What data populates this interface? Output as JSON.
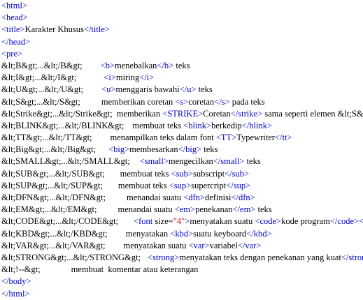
{
  "colors": {
    "tag": "#0000cc",
    "entity": "#000000",
    "text": "#000000",
    "attr_value": "#cc0000"
  },
  "lines": [
    [
      {
        "t": "tag",
        "v": "<html>"
      }
    ],
    [
      {
        "t": "tag",
        "v": "<head>"
      }
    ],
    [
      {
        "t": "tag",
        "v": "<title>"
      },
      {
        "t": "txt",
        "v": "Karakter Khusus"
      },
      {
        "t": "tag",
        "v": "</title>"
      }
    ],
    [
      {
        "t": "tag",
        "v": "</head>"
      }
    ],
    [
      {
        "t": "tag",
        "v": "<pre>"
      }
    ],
    [
      {
        "t": "ent",
        "v": "&lt;B&gt;...&lt;/B&gt;"
      },
      {
        "t": "sp",
        "w": 26
      },
      {
        "t": "tag",
        "v": "<b>"
      },
      {
        "t": "txt",
        "v": "menebalkan"
      },
      {
        "t": "tag",
        "v": "</b>"
      },
      {
        "t": "txt",
        "v": " teks"
      }
    ],
    [
      {
        "t": "ent",
        "v": "&lt;I&gt;...&lt;/I&gt;"
      },
      {
        "t": "sp",
        "w": 39
      },
      {
        "t": "tag",
        "v": "<i>"
      },
      {
        "t": "txt",
        "v": "miring"
      },
      {
        "t": "tag",
        "v": "</i>"
      }
    ],
    [
      {
        "t": "ent",
        "v": "&lt;U&gt;...&lt;/U&gt;"
      },
      {
        "t": "sp",
        "w": 26
      },
      {
        "t": "tag",
        "v": "<u>"
      },
      {
        "t": "txt",
        "v": "menggaris bawahi"
      },
      {
        "t": "tag",
        "v": "</u>"
      },
      {
        "t": "txt",
        "v": " teks"
      }
    ],
    [
      {
        "t": "ent",
        "v": "&lt;S&gt;...&lt;/S&gt;"
      },
      {
        "t": "sp",
        "w": 30
      },
      {
        "t": "txt",
        "v": "memberikan coretan "
      },
      {
        "t": "tag",
        "v": "<s>"
      },
      {
        "t": "txt",
        "v": "coretan"
      },
      {
        "t": "tag",
        "v": "</s>"
      },
      {
        "t": "txt",
        "v": " pada teks"
      }
    ],
    [
      {
        "t": "ent",
        "v": "&lt;Strike&gt;...&lt;/Strike&gt;"
      },
      {
        "t": "sp",
        "w": 6
      },
      {
        "t": "txt",
        "v": "memberikan "
      },
      {
        "t": "tag",
        "v": "<STRIKE>"
      },
      {
        "t": "txt",
        "v": "Coretan"
      },
      {
        "t": "tag",
        "v": "</strike>"
      },
      {
        "t": "txt",
        "v": " sama seperti elemen &lt;S&gt;"
      }
    ],
    [
      {
        "t": "ent",
        "v": "&lt;BLINK&gt;...&lt;/BLINK&gt;"
      },
      {
        "t": "sp",
        "w": 12
      },
      {
        "t": "txt",
        "v": "membuat teks "
      },
      {
        "t": "tag",
        "v": "<blink>"
      },
      {
        "t": "txt",
        "v": "berkedip"
      },
      {
        "t": "tag",
        "v": "</blink>"
      }
    ],
    [
      {
        "t": "ent",
        "v": "&lt;TT&gt;...&lt;/TT&gt;"
      },
      {
        "t": "sp",
        "w": 26
      },
      {
        "t": "txt",
        "v": "menampilkan teks dalam font "
      },
      {
        "t": "tag",
        "v": "<TT>"
      },
      {
        "t": "txt",
        "v": "Typewriter"
      },
      {
        "t": "tag",
        "v": "</tt>"
      }
    ],
    [
      {
        "t": "ent",
        "v": "&lt;Big&gt;...&lt;/Big&gt;"
      },
      {
        "t": "sp",
        "w": 18
      },
      {
        "t": "tag",
        "v": "<big>"
      },
      {
        "t": "txt",
        "v": "membesarkan"
      },
      {
        "t": "tag",
        "v": "</big>"
      },
      {
        "t": "txt",
        "v": " teks"
      }
    ],
    [
      {
        "t": "ent",
        "v": "&lt;SMALL&gt;...&lt;/SMALL&gt;"
      },
      {
        "t": "sp",
        "w": 14
      },
      {
        "t": "tag",
        "v": "<small>"
      },
      {
        "t": "txt",
        "v": "mengecilkan"
      },
      {
        "t": "tag",
        "v": "</small>"
      },
      {
        "t": "txt",
        "v": " teks"
      }
    ],
    [
      {
        "t": "ent",
        "v": "&lt;SUB&gt;...&lt;/SUB&gt;"
      },
      {
        "t": "sp",
        "w": 22
      },
      {
        "t": "txt",
        "v": "membuat teks "
      },
      {
        "t": "tag",
        "v": "<sub>"
      },
      {
        "t": "txt",
        "v": "subscript"
      },
      {
        "t": "tag",
        "v": "</sub>"
      }
    ],
    [
      {
        "t": "ent",
        "v": "&lt;SUP&gt;...&lt;/SUP&gt;"
      },
      {
        "t": "sp",
        "w": 22
      },
      {
        "t": "txt",
        "v": "membuat teks "
      },
      {
        "t": "tag",
        "v": "<sup>"
      },
      {
        "t": "txt",
        "v": "supercript"
      },
      {
        "t": "tag",
        "v": "</sup>"
      }
    ],
    [
      {
        "t": "ent",
        "v": "&lt;DFN&gt;...&lt;/DFN&gt;"
      },
      {
        "t": "sp",
        "w": 30
      },
      {
        "t": "txt",
        "v": "menandai suatu "
      },
      {
        "t": "tag",
        "v": "<dfn>"
      },
      {
        "t": "txt",
        "v": "definisi"
      },
      {
        "t": "tag",
        "v": "</dfn>"
      }
    ],
    [
      {
        "t": "ent",
        "v": "&lt;EM&gt;...&lt;/EM&gt;"
      },
      {
        "t": "sp",
        "w": 30
      },
      {
        "t": "txt",
        "v": "menandai suatu "
      },
      {
        "t": "tag",
        "v": "<em>"
      },
      {
        "t": "txt",
        "v": "penekanan"
      },
      {
        "t": "tag",
        "v": "</em>"
      },
      {
        "t": "txt",
        "v": " teks"
      }
    ],
    [
      {
        "t": "ent",
        "v": "&lt;CODE&gt;...&lt;/CODE&gt;"
      },
      {
        "t": "sp",
        "w": 22
      },
      {
        "t": "tag",
        "v": "<font"
      },
      {
        "t": "txt",
        "v": " size="
      },
      {
        "t": "val",
        "v": "\"4\""
      },
      {
        "t": "tag",
        "v": ">"
      },
      {
        "t": "txt",
        "v": "menyatakan suatu "
      },
      {
        "t": "tag",
        "v": "<code>"
      },
      {
        "t": "txt",
        "v": "kode program"
      },
      {
        "t": "tag",
        "v": "</code></font>"
      }
    ],
    [
      {
        "t": "ent",
        "v": "&lt;KBD&gt;...&lt;/KBD&gt;"
      },
      {
        "t": "sp",
        "w": 26
      },
      {
        "t": "txt",
        "v": "menyatakan "
      },
      {
        "t": "tag",
        "v": "<kbd>"
      },
      {
        "t": "txt",
        "v": "suatu keyboard"
      },
      {
        "t": "tag",
        "v": "</kbd>"
      }
    ],
    [
      {
        "t": "ent",
        "v": "&lt;VAR&gt;...&lt;/VAR&gt;"
      },
      {
        "t": "sp",
        "w": 26
      },
      {
        "t": "txt",
        "v": "menyatakan suatu "
      },
      {
        "t": "tag",
        "v": "<var>"
      },
      {
        "t": "txt",
        "v": "variabel"
      },
      {
        "t": "tag",
        "v": "</var>"
      }
    ],
    [
      {
        "t": "ent",
        "v": "&lt;STRONG&gt;...&lt;/STRONG&gt;"
      },
      {
        "t": "sp",
        "w": 10
      },
      {
        "t": "tag",
        "v": "<strong>"
      },
      {
        "t": "txt",
        "v": "menyatakan teks dengan penekanan yang kuat"
      },
      {
        "t": "tag",
        "v": "</strong>"
      }
    ],
    [
      {
        "t": "ent",
        "v": "&lt;!--&gt;"
      },
      {
        "t": "sp",
        "w": 44
      },
      {
        "t": "txt",
        "v": "membuat  komentar atau keterangan"
      }
    ],
    [
      {
        "t": "tag",
        "v": "</body>"
      }
    ],
    [
      {
        "t": "tag",
        "v": "</html>"
      }
    ]
  ]
}
